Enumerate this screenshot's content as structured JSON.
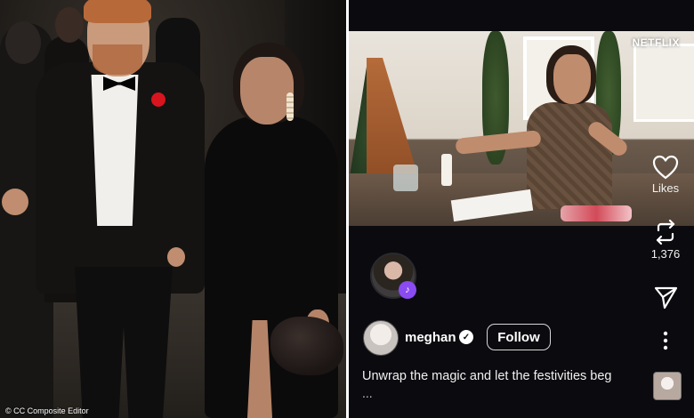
{
  "photo_credit": "© CC Composite Editor",
  "video": {
    "watermark": "NETFLIX"
  },
  "actions": {
    "likes_label": "Likes",
    "reposts_count": "1,376"
  },
  "post": {
    "username": "meghan",
    "follow_label": "Follow",
    "caption": "Unwrap the magic and let the festivities beg",
    "caption_more": "..."
  },
  "colors": {
    "screen_bg": "#0a0a0f",
    "music_badge": "#8a4bf2",
    "poppy": "#d8141e"
  },
  "icons": [
    "heart-icon",
    "repost-icon",
    "send-icon",
    "more-icon",
    "verified-icon",
    "music-icon"
  ]
}
